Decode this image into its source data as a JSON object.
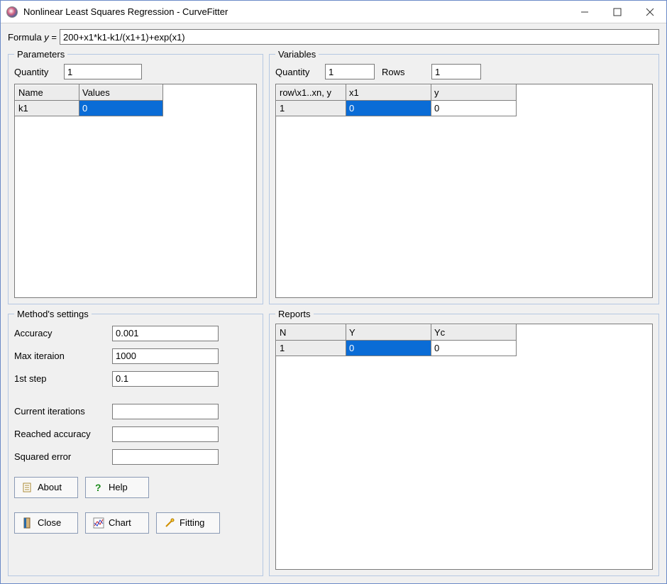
{
  "window": {
    "title": "Nonlinear Least Squares Regression - CurveFitter"
  },
  "formula": {
    "label_prefix": "Formula ",
    "label_var": "y",
    "label_eq": " = ",
    "value": "200+x1*k1-k1/(x1+1)+exp(x1)"
  },
  "parameters": {
    "legend": "Parameters",
    "quantity_label": "Quantity",
    "quantity": "1",
    "headers": {
      "name": "Name",
      "values": "Values"
    },
    "rows": [
      {
        "name": "k1",
        "value": "0",
        "selected": true
      }
    ]
  },
  "variables": {
    "legend": "Variables",
    "quantity_label": "Quantity",
    "quantity": "1",
    "rows_label": "Rows",
    "rows_count": "1",
    "headers": {
      "row": "row\\x1..xn, y",
      "x1": "x1",
      "y": "y"
    },
    "rows": [
      {
        "row": "1",
        "x1": "0",
        "x1_selected": true,
        "y": "0"
      }
    ]
  },
  "method": {
    "legend": "Method's settings",
    "accuracy_label": "Accuracy",
    "accuracy": "0.001",
    "maxiter_label": "Max iteraion",
    "maxiter": "1000",
    "step_label": "1st step",
    "step": "0.1",
    "cur_iter_label": "Current iterations",
    "cur_iter": "",
    "reached_label": "Reached accuracy",
    "reached": "",
    "sqerr_label": "Squared error",
    "sqerr": ""
  },
  "reports": {
    "legend": "Reports",
    "headers": {
      "n": "N",
      "y": "Y",
      "yc": "Yc"
    },
    "rows": [
      {
        "n": "1",
        "y": "0",
        "y_selected": true,
        "yc": "0"
      }
    ]
  },
  "buttons": {
    "about": "About",
    "help": "Help",
    "close": "Close",
    "chart": "Chart",
    "fitting": "Fitting"
  }
}
